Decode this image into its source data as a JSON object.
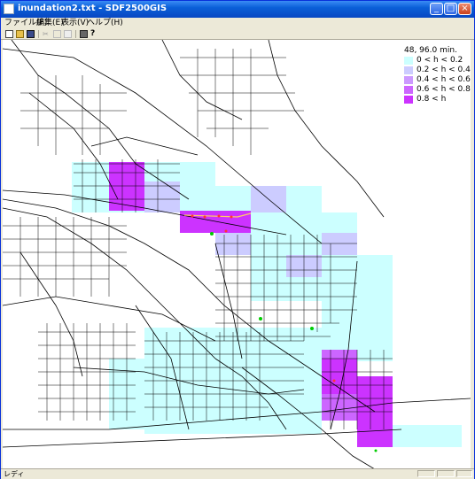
{
  "window": {
    "title": "inundation2.txt - SDF2500GIS",
    "controls": {
      "minimize": "_",
      "maximize": "□",
      "close": "×"
    }
  },
  "menubar": {
    "items": [
      "ファイル(F)",
      "編集(E)",
      "表示(V)",
      "ヘルプ(H)"
    ]
  },
  "toolbar": {
    "buttons": [
      "new-icon",
      "open-icon",
      "save-icon",
      "cut-icon",
      "copy-icon",
      "paste-icon",
      "print-icon",
      "help-icon"
    ]
  },
  "legend": {
    "header": "48,  96.0 min.",
    "items": [
      {
        "label": "0 < h < 0.2",
        "color": "#ccffff"
      },
      {
        "label": "0.2 < h < 0.4",
        "color": "#ccccff"
      },
      {
        "label": "0.4 < h < 0.6",
        "color": "#cc99ff"
      },
      {
        "label": "0.6 < h < 0.8",
        "color": "#cc66ff"
      },
      {
        "label": "0.8 < h",
        "color": "#cc33ff"
      }
    ]
  },
  "status": {
    "text": "レディ"
  },
  "colors": {
    "titlebar": "#0a5fd8",
    "road": "#000000",
    "marker_green": "#00cc00",
    "marker_red": "#ff3333"
  }
}
